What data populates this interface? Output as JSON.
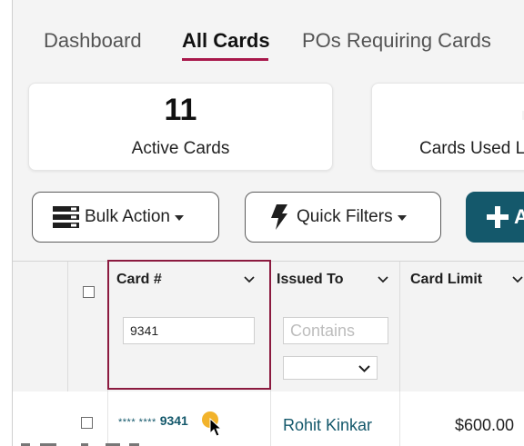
{
  "tabs": [
    {
      "label": "Dashboard",
      "active": false
    },
    {
      "label": "All Cards",
      "active": true
    },
    {
      "label": "POs Requiring Cards",
      "active": false
    }
  ],
  "stats": {
    "active_number": "11",
    "active_label": "Active Cards",
    "used_label": "Cards Used L"
  },
  "toolbar": {
    "bulk_label": "Bulk Action",
    "quick_label": "Quick Filters",
    "add_label": "+",
    "add_text": "A"
  },
  "grid": {
    "columns": [
      {
        "label": "Card #"
      },
      {
        "label": "Issued To"
      },
      {
        "label": "Card Limit"
      }
    ],
    "filters": {
      "card_value": "9341",
      "issued_placeholder": "Contains"
    },
    "rows": [
      {
        "card_mask": "**** ****",
        "card_last": "9341",
        "issued_to": "Rohit Kinkar",
        "limit": "$600.00"
      }
    ]
  },
  "colors": {
    "accent": "#a8174a",
    "highlight": "#8b1a3f",
    "primary": "#14586b",
    "cursor_dot": "#f2b32b"
  }
}
